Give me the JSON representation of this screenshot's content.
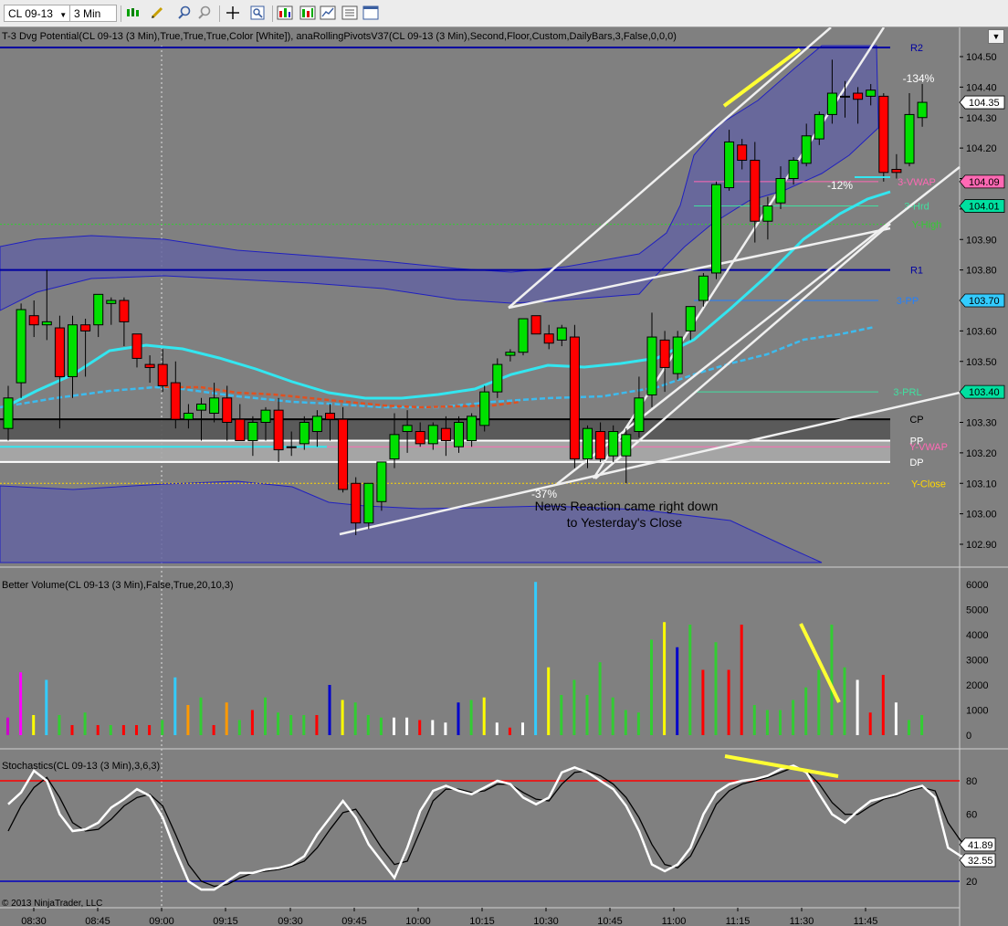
{
  "toolbar": {
    "instrument": "CL 09-13",
    "timeframe": "3 Min"
  },
  "colors": {
    "background": "#808080",
    "up_candle": "#00e000",
    "down_candle": "#ff0000",
    "pivot_line": "#0000a0",
    "cloud": "#6464a0",
    "cyan": "#33e6f0",
    "stoch_fast": "#ffffff",
    "stoch_slow": "#000000",
    "annotation_yellow": "#ffff33"
  },
  "chart_data": [
    {
      "type": "candlestick",
      "panel": "price",
      "indicator_label": "T-3 Dvg Potential(CL 09-13 (3 Min),True,True,True,Color [White]), anaRollingPivotsV37(CL 09-13 (3 Min),Second,Floor,Custom,DailyBars,3,False,0,0,0)",
      "x_ticks": [
        "08:30",
        "08:45",
        "09:00",
        "09:15",
        "09:30",
        "09:45",
        "10:00",
        "10:15",
        "10:30",
        "10:45",
        "11:00",
        "11:15",
        "11:30",
        "11:45"
      ],
      "y_ticks": [
        "104.50",
        "104.40",
        "104.30",
        "104.20",
        "104.10",
        "104.00",
        "103.90",
        "103.80",
        "103.70",
        "103.60",
        "103.50",
        "103.40",
        "103.30",
        "103.20",
        "103.10",
        "103.00",
        "102.90"
      ],
      "ylim": [
        102.86,
        104.56
      ],
      "candles": [
        {
          "o": 103.28,
          "h": 103.42,
          "l": 103.24,
          "c": 103.38
        },
        {
          "o": 103.43,
          "h": 103.69,
          "l": 103.38,
          "c": 103.67
        },
        {
          "o": 103.65,
          "h": 103.7,
          "l": 103.58,
          "c": 103.62
        },
        {
          "o": 103.62,
          "h": 103.8,
          "l": 103.57,
          "c": 103.63
        },
        {
          "o": 103.61,
          "h": 103.65,
          "l": 103.28,
          "c": 103.45
        },
        {
          "o": 103.45,
          "h": 103.65,
          "l": 103.38,
          "c": 103.62
        },
        {
          "o": 103.62,
          "h": 103.64,
          "l": 103.45,
          "c": 103.6
        },
        {
          "o": 103.62,
          "h": 103.72,
          "l": 103.58,
          "c": 103.72
        },
        {
          "o": 103.69,
          "h": 103.71,
          "l": 103.62,
          "c": 103.7
        },
        {
          "o": 103.7,
          "h": 103.71,
          "l": 103.55,
          "c": 103.63
        },
        {
          "o": 103.59,
          "h": 103.59,
          "l": 103.48,
          "c": 103.51
        },
        {
          "o": 103.49,
          "h": 103.52,
          "l": 103.43,
          "c": 103.48
        },
        {
          "o": 103.49,
          "h": 103.54,
          "l": 103.4,
          "c": 103.42
        },
        {
          "o": 103.43,
          "h": 103.5,
          "l": 103.28,
          "c": 103.31
        },
        {
          "o": 103.31,
          "h": 103.36,
          "l": 103.28,
          "c": 103.33
        },
        {
          "o": 103.34,
          "h": 103.38,
          "l": 103.24,
          "c": 103.36
        },
        {
          "o": 103.33,
          "h": 103.43,
          "l": 103.3,
          "c": 103.38
        },
        {
          "o": 103.38,
          "h": 103.42,
          "l": 103.24,
          "c": 103.3
        },
        {
          "o": 103.31,
          "h": 103.36,
          "l": 103.24,
          "c": 103.24
        },
        {
          "o": 103.24,
          "h": 103.32,
          "l": 103.19,
          "c": 103.3
        },
        {
          "o": 103.3,
          "h": 103.35,
          "l": 103.24,
          "c": 103.34
        },
        {
          "o": 103.34,
          "h": 103.38,
          "l": 103.17,
          "c": 103.21
        },
        {
          "o": 103.22,
          "h": 103.27,
          "l": 103.19,
          "c": 103.22
        },
        {
          "o": 103.23,
          "h": 103.32,
          "l": 103.21,
          "c": 103.3
        },
        {
          "o": 103.27,
          "h": 103.34,
          "l": 103.22,
          "c": 103.32
        },
        {
          "o": 103.33,
          "h": 103.36,
          "l": 103.24,
          "c": 103.31
        },
        {
          "o": 103.31,
          "h": 103.35,
          "l": 103.07,
          "c": 103.08
        },
        {
          "o": 103.1,
          "h": 103.12,
          "l": 102.93,
          "c": 102.97
        },
        {
          "o": 102.97,
          "h": 103.1,
          "l": 102.95,
          "c": 103.1
        },
        {
          "o": 103.04,
          "h": 103.17,
          "l": 103.01,
          "c": 103.17
        },
        {
          "o": 103.18,
          "h": 103.33,
          "l": 103.15,
          "c": 103.26
        },
        {
          "o": 103.27,
          "h": 103.34,
          "l": 103.2,
          "c": 103.29
        },
        {
          "o": 103.27,
          "h": 103.3,
          "l": 103.22,
          "c": 103.23
        },
        {
          "o": 103.23,
          "h": 103.3,
          "l": 103.21,
          "c": 103.29
        },
        {
          "o": 103.28,
          "h": 103.32,
          "l": 103.19,
          "c": 103.24
        },
        {
          "o": 103.22,
          "h": 103.32,
          "l": 103.2,
          "c": 103.3
        },
        {
          "o": 103.24,
          "h": 103.33,
          "l": 103.22,
          "c": 103.32
        },
        {
          "o": 103.29,
          "h": 103.42,
          "l": 103.27,
          "c": 103.4
        },
        {
          "o": 103.4,
          "h": 103.51,
          "l": 103.38,
          "c": 103.49
        },
        {
          "o": 103.52,
          "h": 103.54,
          "l": 103.5,
          "c": 103.53
        },
        {
          "o": 103.53,
          "h": 103.64,
          "l": 103.52,
          "c": 103.64
        },
        {
          "o": 103.65,
          "h": 103.65,
          "l": 103.59,
          "c": 103.59
        },
        {
          "o": 103.59,
          "h": 103.62,
          "l": 103.54,
          "c": 103.56
        },
        {
          "o": 103.57,
          "h": 103.62,
          "l": 103.55,
          "c": 103.61
        },
        {
          "o": 103.58,
          "h": 103.62,
          "l": 103.15,
          "c": 103.18
        },
        {
          "o": 103.18,
          "h": 103.29,
          "l": 103.15,
          "c": 103.28
        },
        {
          "o": 103.27,
          "h": 103.3,
          "l": 103.17,
          "c": 103.18
        },
        {
          "o": 103.19,
          "h": 103.29,
          "l": 103.17,
          "c": 103.27
        },
        {
          "o": 103.19,
          "h": 103.28,
          "l": 103.1,
          "c": 103.26
        },
        {
          "o": 103.27,
          "h": 103.45,
          "l": 103.25,
          "c": 103.38
        },
        {
          "o": 103.39,
          "h": 103.66,
          "l": 103.35,
          "c": 103.58
        },
        {
          "o": 103.57,
          "h": 103.6,
          "l": 103.4,
          "c": 103.48
        },
        {
          "o": 103.46,
          "h": 103.6,
          "l": 103.44,
          "c": 103.58
        },
        {
          "o": 103.6,
          "h": 103.68,
          "l": 103.57,
          "c": 103.68
        },
        {
          "o": 103.7,
          "h": 103.79,
          "l": 103.68,
          "c": 103.78
        },
        {
          "o": 103.79,
          "h": 104.09,
          "l": 103.77,
          "c": 104.08
        },
        {
          "o": 104.07,
          "h": 104.26,
          "l": 104.06,
          "c": 104.22
        },
        {
          "o": 104.21,
          "h": 104.23,
          "l": 104.13,
          "c": 104.16
        },
        {
          "o": 104.16,
          "h": 104.22,
          "l": 103.89,
          "c": 103.96
        },
        {
          "o": 103.96,
          "h": 104.04,
          "l": 103.9,
          "c": 104.01
        },
        {
          "o": 104.02,
          "h": 104.14,
          "l": 104.0,
          "c": 104.1
        },
        {
          "o": 104.1,
          "h": 104.17,
          "l": 104.08,
          "c": 104.16
        },
        {
          "o": 104.15,
          "h": 104.28,
          "l": 104.14,
          "c": 104.24
        },
        {
          "o": 104.23,
          "h": 104.32,
          "l": 104.21,
          "c": 104.31
        },
        {
          "o": 104.31,
          "h": 104.49,
          "l": 104.28,
          "c": 104.38
        },
        {
          "o": 104.37,
          "h": 104.42,
          "l": 104.3,
          "c": 104.37
        },
        {
          "o": 104.38,
          "h": 104.4,
          "l": 104.28,
          "c": 104.36
        },
        {
          "o": 104.37,
          "h": 104.41,
          "l": 104.34,
          "c": 104.39
        },
        {
          "o": 104.37,
          "h": 104.38,
          "l": 104.09,
          "c": 104.12
        },
        {
          "o": 104.13,
          "h": 104.18,
          "l": 104.1,
          "c": 104.12
        },
        {
          "o": 104.15,
          "h": 104.38,
          "l": 104.14,
          "c": 104.31
        },
        {
          "o": 104.3,
          "h": 104.41,
          "l": 104.27,
          "c": 104.35
        }
      ],
      "levels": [
        {
          "name": "R2",
          "value": 104.53,
          "color": "#0000a0"
        },
        {
          "name": "3-VWAP",
          "value": 104.09,
          "color": "#ff69b4"
        },
        {
          "name": "3-Hrd",
          "value": 104.01,
          "color": "#40e0a0"
        },
        {
          "name": "Y-High",
          "value": 103.95,
          "color": "#32cd32"
        },
        {
          "name": "R1",
          "value": 103.8,
          "color": "#0000a0"
        },
        {
          "name": "3-PP",
          "value": 103.7,
          "color": "#2080ff"
        },
        {
          "name": "3-PRL",
          "value": 103.4,
          "color": "#40e0a0"
        },
        {
          "name": "CP",
          "value": 103.31,
          "color": "#000000"
        },
        {
          "name": "PP",
          "value": 103.24,
          "color": "#ffffff"
        },
        {
          "name": "Y-VWAP",
          "value": 103.22,
          "color": "#ff69b4"
        },
        {
          "name": "DP",
          "value": 103.17,
          "color": "#ffffff"
        },
        {
          "name": "Y-Close",
          "value": 103.1,
          "color": "#ffd700"
        }
      ],
      "price_tags": [
        {
          "label": "104.35",
          "value": 104.35,
          "bg": "#ffffff",
          "fg": "#000000"
        },
        {
          "label": "104.09",
          "value": 104.09,
          "bg": "#ff69b4",
          "fg": "#000000"
        },
        {
          "label": "104.01",
          "value": 104.01,
          "bg": "#00e0a0",
          "fg": "#000000"
        },
        {
          "label": "103.70",
          "value": 103.7,
          "bg": "#33ccff",
          "fg": "#000000"
        },
        {
          "label": "103.40",
          "value": 103.4,
          "bg": "#00e0a0",
          "fg": "#000000"
        }
      ],
      "annotations": {
        "news": "News Reaction came right down\n to Yesterday's Close",
        "pct_low": "-37%",
        "pct_high": "-134%",
        "pct_mid": "-12%"
      }
    },
    {
      "type": "bar",
      "panel": "volume",
      "indicator_label": "Better Volume(CL 09-13 (3 Min),False,True,20,10,3)",
      "y_ticks": [
        "6000",
        "5000",
        "4000",
        "3000",
        "2000",
        "1000",
        "0"
      ],
      "ylim": [
        0,
        6300
      ],
      "values": [
        700,
        2500,
        800,
        2200,
        800,
        400,
        900,
        400,
        400,
        400,
        400,
        400,
        600,
        2300,
        1200,
        1500,
        400,
        1300,
        600,
        1000,
        1500,
        900,
        800,
        800,
        800,
        2000,
        1400,
        1300,
        800,
        700,
        700,
        700,
        600,
        600,
        500,
        1300,
        1400,
        1500,
        500,
        300,
        500,
        6100,
        2700,
        1600,
        2200,
        1600,
        2900,
        1500,
        1000,
        900,
        3800,
        4500,
        3500,
        4400,
        2600,
        3700,
        2600,
        4400,
        1200,
        1000,
        1000,
        1400,
        1900,
        2600,
        4400,
        2700,
        2200,
        900,
        2400,
        1300,
        600,
        800
      ],
      "colors": [
        "#cc00cc",
        "#ff00ff",
        "#ffff00",
        "#33ccff",
        "#33cc33",
        "#ff0000",
        "#33cc33",
        "#ff0000",
        "#33cc33",
        "#ff0000",
        "#ff0000",
        "#ff0000",
        "#33cc33",
        "#33ccff",
        "#ff9900",
        "#33cc33",
        "#ff0000",
        "#ff9900",
        "#33cc33",
        "#ff0000",
        "#33cc33",
        "#33cc33",
        "#33cc33",
        "#33cc33",
        "#ff0000",
        "#0000cc",
        "#ffff00",
        "#33cc33",
        "#33cc33",
        "#33cc33",
        "#ffffff",
        "#ffffff",
        "#ff0000",
        "#ffffff",
        "#ffffff",
        "#0000cc",
        "#33cc33",
        "#ffff00",
        "#ffffff",
        "#ff0000",
        "#ffffff",
        "#33ccff",
        "#ffff00",
        "#33cc33",
        "#33cc33",
        "#33cc33",
        "#33cc33",
        "#33cc33",
        "#33cc33",
        "#33cc33",
        "#33cc33",
        "#ffff00",
        "#0000cc",
        "#33cc33",
        "#ff0000",
        "#33cc33",
        "#ff0000",
        "#ff0000",
        "#33cc33",
        "#33cc33",
        "#33cc33",
        "#33cc33",
        "#33cc33",
        "#33cc33",
        "#33cc33",
        "#33cc33",
        "#ffffff",
        "#ff0000",
        "#ff0000",
        "#ffffff",
        "#33cc33",
        "#33cc33"
      ]
    },
    {
      "type": "line",
      "panel": "stochastics",
      "indicator_label": "Stochastics(CL 09-13 (3 Min),3,6,3)",
      "y_ticks": [
        "80",
        "60",
        "20"
      ],
      "ylim": [
        14,
        91
      ],
      "series": [
        {
          "role": "fast",
          "color": "#ffffff",
          "values": [
            66,
            73,
            86,
            80,
            60,
            50,
            51,
            55,
            64,
            69,
            75,
            71,
            58,
            38,
            20,
            15,
            15,
            20,
            25,
            25,
            27,
            28,
            30,
            35,
            48,
            58,
            68,
            58,
            42,
            32,
            22,
            40,
            62,
            74,
            77,
            74,
            72,
            76,
            80,
            78,
            70,
            66,
            70,
            85,
            88,
            85,
            80,
            75,
            65,
            50,
            30,
            26,
            30,
            40,
            60,
            73,
            78,
            80,
            81,
            83,
            87,
            89,
            85,
            72,
            60,
            55,
            62,
            68,
            70,
            72,
            75,
            77,
            70,
            40,
            35,
            33
          ]
        },
        {
          "role": "slow",
          "color": "#000000",
          "values": [
            50,
            65,
            76,
            82,
            70,
            55,
            50,
            51,
            57,
            65,
            70,
            72,
            65,
            48,
            30,
            20,
            17,
            18,
            22,
            25,
            26,
            27,
            29,
            32,
            40,
            51,
            61,
            63,
            52,
            40,
            30,
            32,
            50,
            68,
            75,
            75,
            73,
            74,
            78,
            78,
            73,
            69,
            68,
            78,
            85,
            86,
            83,
            78,
            70,
            58,
            42,
            30,
            28,
            35,
            50,
            66,
            74,
            78,
            80,
            82,
            85,
            88,
            86,
            78,
            67,
            60,
            60,
            65,
            69,
            71,
            74,
            76,
            74,
            55,
            44,
            42
          ]
        }
      ],
      "readouts": [
        {
          "label": "41.89",
          "value": 41.89,
          "bg": "#ffffff",
          "fg": "#000000"
        },
        {
          "label": "32.55",
          "value": 32.55,
          "bg": "#ffffff",
          "fg": "#000000"
        }
      ]
    }
  ],
  "copyright": "© 2013 NinjaTrader, LLC"
}
